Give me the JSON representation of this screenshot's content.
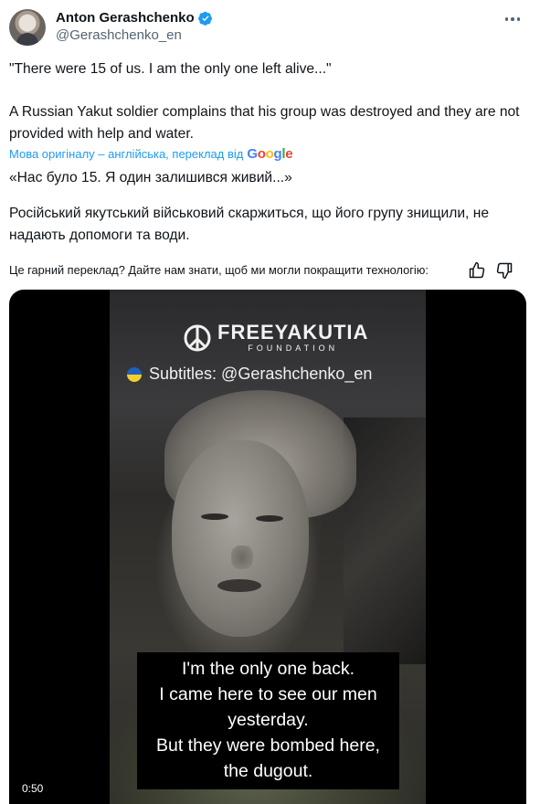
{
  "author": {
    "name": "Anton Gerashchenko",
    "handle": "@Gerashchenko_en",
    "verified": true,
    "verified_color": "#1d9bf0"
  },
  "more_icon": "more-dots-icon",
  "tweet": {
    "original_quote": "\"There were 15 of us. I am the only one left alive...\"",
    "original_body": "A Russian Yakut soldier complains that his group was destroyed and they are not provided with help and water.",
    "translation_source": "Мова оригіналу – англійська, переклад від",
    "translation_provider": "Google",
    "translated_quote": "«Нас було 15. Я один залишився живий...»",
    "translated_body": "Російський якутський військовий скаржиться, що його групу знищили, не надають допомоги та води."
  },
  "feedback": {
    "prompt": "Це гарний переклад? Дайте нам знати, щоб ми могли покращити технологію:",
    "like_icon": "thumbs-up-icon",
    "dislike_icon": "thumbs-down-icon"
  },
  "video": {
    "logo_title": "FREEYAKUTIA",
    "logo_subtitle": "FOUNDATION",
    "subtitles_credit": "Subtitles: @Gerashchenko_en",
    "caption_lines": [
      "I'm the only one back.",
      "I came here to see our men",
      "yesterday.",
      "But they were bombed here,",
      "the dugout."
    ],
    "duration": "0:50"
  },
  "colors": {
    "link": "#1d9bf0",
    "text": "#0f1419",
    "secondary": "#536471",
    "flag_blue": "#1f5fbf",
    "flag_yellow": "#f5d02a"
  }
}
